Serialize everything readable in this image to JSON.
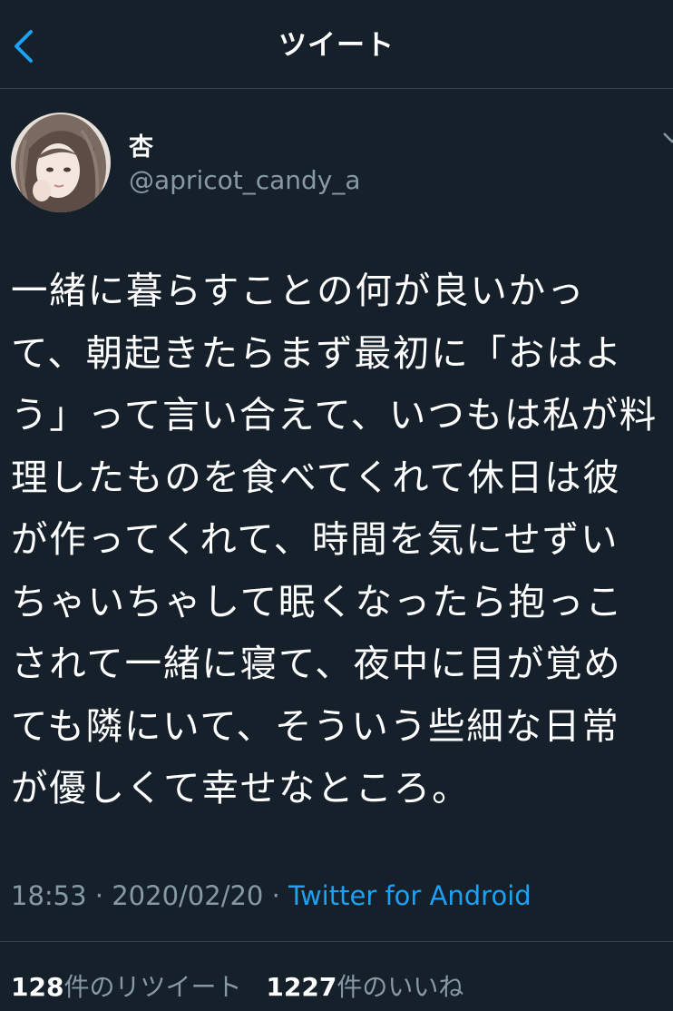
{
  "header": {
    "title": "ツイート"
  },
  "author": {
    "name": "杏",
    "handle": "@apricot_candy_a"
  },
  "tweet": {
    "text": "一緒に暮らすことの何が良いかっ\nて、朝起きたらまず最初に「おはよ\nう」って言い合えて、いつもは私が料\n理したものを食べてくれて休日は彼\nが作ってくれて、時間を気にせずい\nちゃいちゃして眠くなったら抱っこ\nされて一緒に寝て、夜中に目が覚め\nても隣にいて、そういう些細な日常\nが優しくて幸せなところ。",
    "time": "18:53",
    "separator": " · ",
    "date": "2020/02/20",
    "source": "Twitter for Android"
  },
  "stats": {
    "retweets_count": "128",
    "retweets_label": "件のリツイート",
    "likes_count": "1227",
    "likes_label": "件のいいね"
  },
  "colors": {
    "background": "#15202b",
    "accent": "#1da1f2",
    "secondary_text": "#8899a6",
    "divider": "#38444d"
  },
  "icons": {
    "back": "chevron-left-icon",
    "more": "chevron-down-icon"
  }
}
